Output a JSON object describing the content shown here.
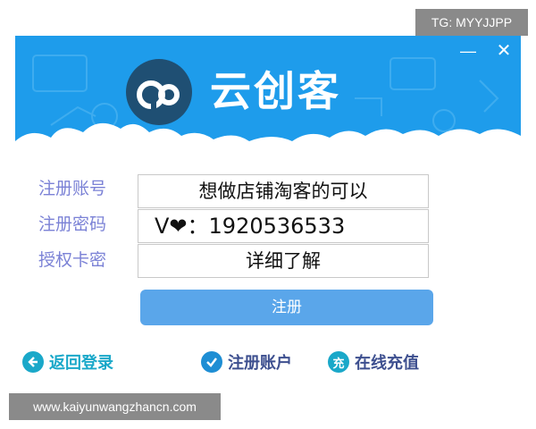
{
  "badge": {
    "text": "TG: MYYJJPP"
  },
  "window": {
    "minimize_glyph": "—",
    "close_glyph": "✕"
  },
  "header": {
    "app_name": "云创客",
    "logo_icon": "cloud-co-logo-icon"
  },
  "form": {
    "account_label": "注册账号",
    "password_label": "注册密码",
    "auth_code_label": "授权卡密",
    "account_value": "想做店铺淘客的可以",
    "password_value_prefix": "V",
    "password_value_heart": "❤",
    "password_value": "：1920536533",
    "auth_code_value": "详细了解",
    "register_button": "注册"
  },
  "footer_links": {
    "back_login": "返回登录",
    "register_account": "注册账户",
    "recharge_icon_text": "充",
    "recharge_online": "在线充值"
  },
  "url_bar": {
    "text": "www.kaiyunwangzhancn.com"
  },
  "colors": {
    "header_blue": "#1e9ceb",
    "label_purple": "#7b82d6",
    "button_blue": "#5aa6ea",
    "link_teal": "#1aa8c9"
  }
}
